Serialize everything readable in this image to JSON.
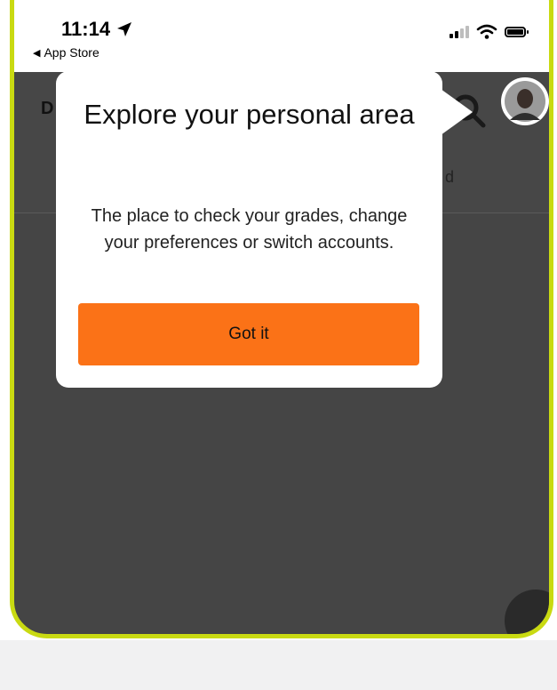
{
  "status_bar": {
    "time": "11:14",
    "back_app": "App Store"
  },
  "header": {
    "initial": "D",
    "partial_text": "d"
  },
  "tooltip": {
    "title": "Explore your personal area",
    "body": "The place to check your grades, change your preferences or switch accounts.",
    "button_label": "Got it"
  },
  "colors": {
    "accent": "#fb7217",
    "frame": "#c9da12",
    "overlay": "#454545"
  },
  "icons": [
    "location-arrow-icon",
    "back-caret-icon",
    "signal-icon",
    "wifi-icon",
    "battery-icon",
    "search-icon",
    "avatar"
  ]
}
